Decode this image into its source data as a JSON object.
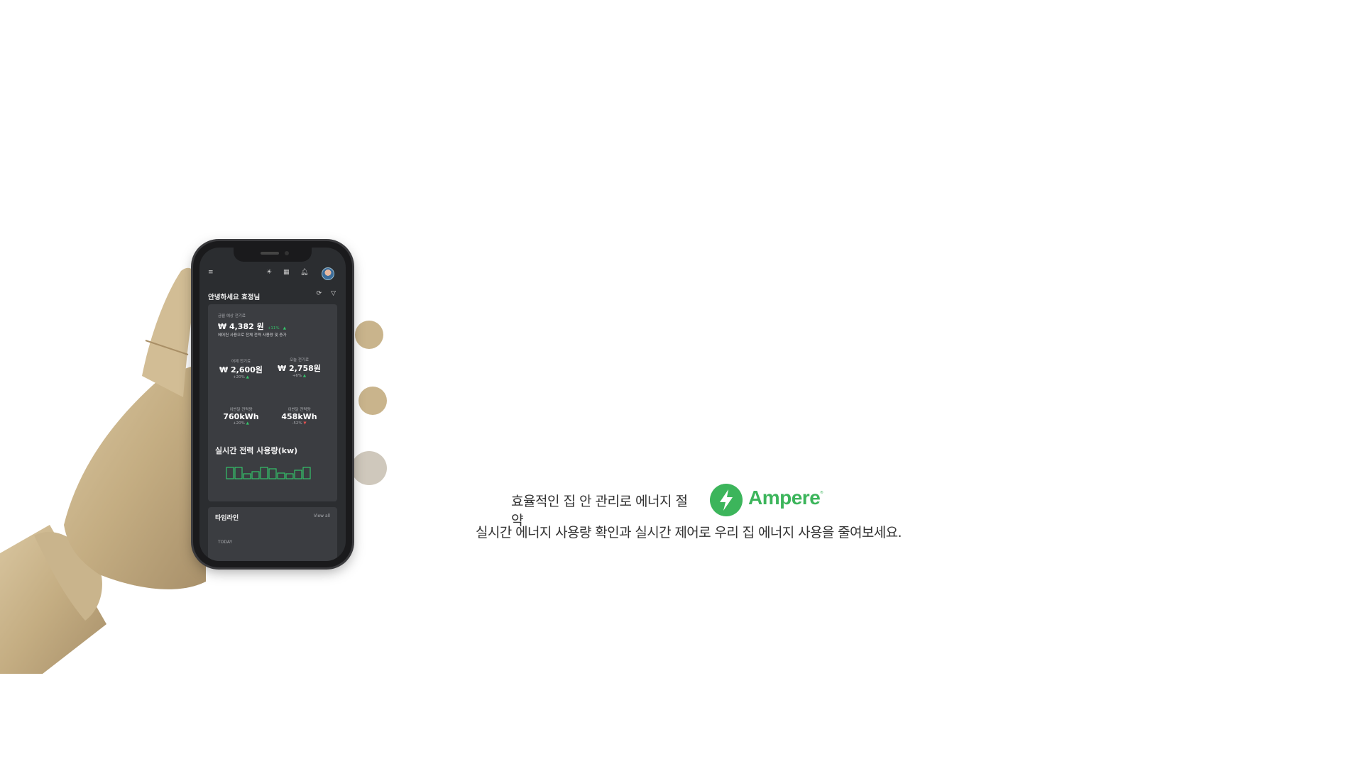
{
  "app": {
    "greeting": "안녕하세요 효정님",
    "monthly_estimate": {
      "label": "금월 예상 전기료",
      "value": "₩ 4,382 원",
      "change": "+11%",
      "note": "에어컨 사용으로 전체 전력 사용량 및 증가"
    },
    "stats": [
      {
        "label": "어제 전기료",
        "value": "₩ 2,600원",
        "change": "+20%",
        "direction": "up"
      },
      {
        "label": "오늘 전기료",
        "value": "₩ 2,758원",
        "change": "+6%",
        "direction": "up"
      },
      {
        "label": "이번달 전력량",
        "value": "760kWh",
        "change": "+20%",
        "direction": "up"
      },
      {
        "label": "이번달 전력량",
        "value": "458kWh",
        "change": "-52%",
        "direction": "down"
      }
    ],
    "realtime_title": "실시간 전력 사용량(kw)",
    "realtime_levels": [
      0.8,
      0.8,
      0.35,
      0.5,
      0.8,
      0.7,
      0.4,
      0.35,
      0.6,
      0.8
    ],
    "timeline": {
      "title": "타임라인",
      "view_all": "View all",
      "today": "TODAY"
    },
    "icons": [
      "menu-icon",
      "brightness-icon",
      "grid-icon",
      "bell-icon",
      "refresh-icon",
      "filter-icon"
    ]
  },
  "hero": {
    "headline": "효율적인 집 안 관리로 에너지 절약",
    "brand": "Ampere",
    "brand_mark": "®",
    "subline": "실시간 에너지 사용량 확인과 실시간 제어로 우리 집 에너지 사용을 줄여보세요."
  },
  "colors": {
    "brand_green": "#3cb55b",
    "screen_bg": "#2b2d30",
    "card_bg": "#3b3d41",
    "up": "#34c36a",
    "down": "#e05050"
  }
}
